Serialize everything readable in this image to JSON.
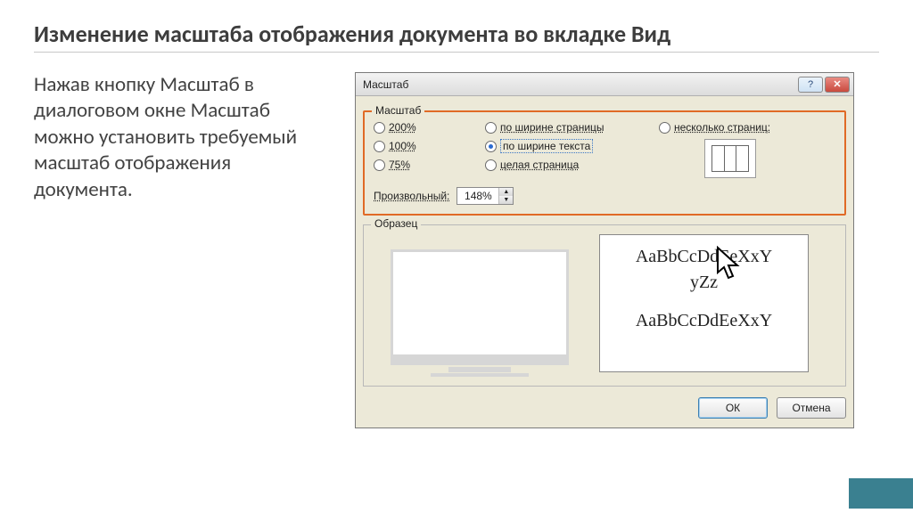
{
  "slide": {
    "title": "Изменение масштаба отображения документа во вкладке Вид",
    "description": "Нажав кнопку Масштаб в диалоговом окне Масштаб можно установить требуемый масштаб отображения документа."
  },
  "dialog": {
    "title": "Масштаб",
    "group_scale": {
      "legend": "Масштаб",
      "options": {
        "p200": "200%",
        "p100": "100%",
        "p75": "75%",
        "page_width": "по ширине страницы",
        "text_width": "по ширине текста",
        "whole_page": "целая страница",
        "many_pages": "несколько страниц:"
      },
      "selected": "text_width",
      "custom_label": "Произвольный:",
      "custom_value": "148%"
    },
    "group_sample": {
      "legend": "Образец",
      "sample_line1": "AaBbCcDdEeXxY",
      "sample_line2": "yZz",
      "sample_line3": "AaBbCcDdEeXxY"
    },
    "buttons": {
      "ok": "ОК",
      "cancel": "Отмена"
    },
    "titlebar": {
      "help": "?",
      "close": "✕"
    }
  }
}
